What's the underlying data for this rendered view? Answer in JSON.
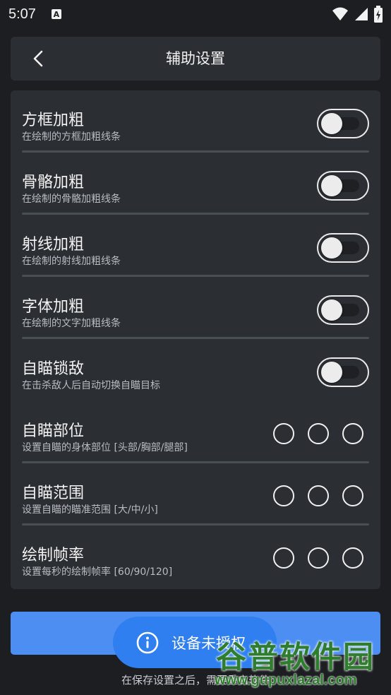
{
  "status_bar": {
    "time": "5:07",
    "app_badge": "A"
  },
  "header": {
    "title": "辅助设置"
  },
  "toggles": [
    {
      "title": "方框加粗",
      "subtitle": "在绘制的方框加粗线条",
      "on": false
    },
    {
      "title": "骨骼加粗",
      "subtitle": "在绘制的骨骼加粗线条",
      "on": false
    },
    {
      "title": "射线加粗",
      "subtitle": "在绘制的射线加粗线条",
      "on": false
    },
    {
      "title": "字体加粗",
      "subtitle": "在绘制的文字加粗线条",
      "on": false
    },
    {
      "title": "自瞄锁敌",
      "subtitle": "在击杀敌人后自动切换自瞄目标",
      "on": false
    }
  ],
  "radio_rows": [
    {
      "title": "自瞄部位",
      "subtitle": "设置自瞄的身体部位 [头部/胸部/腿部]"
    },
    {
      "title": "自瞄范围",
      "subtitle": "设置自瞄的瞄准范围 [大/中/小]"
    },
    {
      "title": "绘制帧率",
      "subtitle": "设置每秒的绘制帧率 [60/90/120]"
    }
  ],
  "toast": {
    "text": "设备未授权"
  },
  "note": {
    "text": "在保存设置之后，需要重启软件"
  },
  "watermark": {
    "top": "谷普软件园",
    "bottom": "www.gupuxlazal.com"
  },
  "colors": {
    "accent": "#4d8ef2",
    "card": "#2b2e33",
    "background": "#1c1e22"
  },
  "icons": [
    "back-arrow-icon",
    "wifi-icon",
    "signal-icon",
    "battery-icon",
    "info-icon"
  ]
}
